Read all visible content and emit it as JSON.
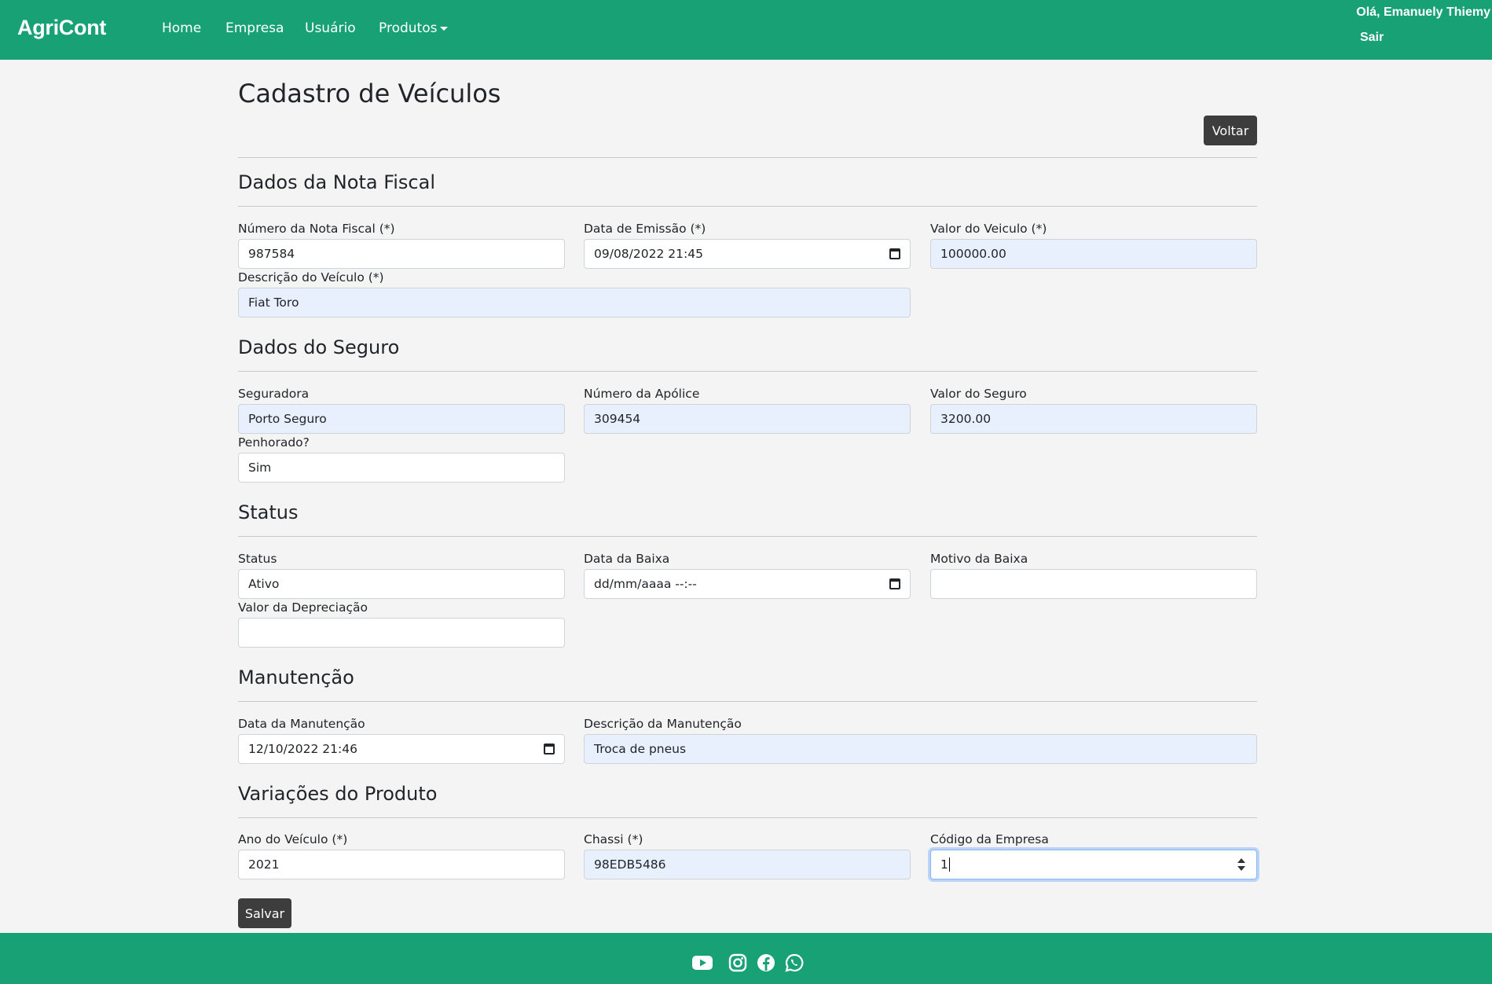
{
  "navbar": {
    "brand": "AgriCont",
    "links": [
      "Home",
      "Empresa",
      "Usuário",
      "Produtos"
    ],
    "greeting": "Olá, Emanuely Thiemy",
    "logout": "Sair"
  },
  "page": {
    "title": "Cadastro de Veículos",
    "back_label": "Voltar",
    "save_label": "Salvar"
  },
  "sections": {
    "nota_fiscal": {
      "title": "Dados da Nota Fiscal",
      "numero_label": "Número da Nota Fiscal (*)",
      "numero_value": "987584",
      "data_label": "Data de Emissão (*)",
      "data_value": "09/08/2022 21:45",
      "valor_label": "Valor do Veiculo (*)",
      "valor_value": "100000.00",
      "descricao_label": "Descrição do Veículo (*)",
      "descricao_value": "Fiat Toro"
    },
    "seguro": {
      "title": "Dados do Seguro",
      "seguradora_label": "Seguradora",
      "seguradora_value": "Porto Seguro",
      "apolice_label": "Número da Apólice",
      "apolice_value": "309454",
      "valor_label": "Valor do Seguro",
      "valor_value": "3200.00",
      "penhorado_label": "Penhorado?",
      "penhorado_value": "Sim"
    },
    "status": {
      "title": "Status",
      "status_label": "Status",
      "status_value": "Ativo",
      "data_baixa_label": "Data da Baixa",
      "data_baixa_value": "dd/mm/aaaa --:--",
      "motivo_label": "Motivo da Baixa",
      "motivo_value": "",
      "depreciacao_label": "Valor da Depreciação",
      "depreciacao_value": ""
    },
    "manutencao": {
      "title": "Manutenção",
      "data_label": "Data da Manutenção",
      "data_value": "12/10/2022 21:46",
      "descricao_label": "Descrição da Manutenção",
      "descricao_value": "Troca de pneus"
    },
    "variacoes": {
      "title": "Variações do Produto",
      "ano_label": "Ano do Veículo (*)",
      "ano_value": "2021",
      "chassi_label": "Chassi (*)",
      "chassi_value": "98EDB5486",
      "codigo_label": "Código da Empresa",
      "codigo_value": "1"
    }
  },
  "footer": {
    "icons": [
      "youtube-icon",
      "instagram-icon",
      "facebook-icon",
      "whatsapp-icon"
    ]
  },
  "colors": {
    "brand": "#18a174",
    "button": "#3d3d3d",
    "autofill": "#e8f0fe"
  }
}
